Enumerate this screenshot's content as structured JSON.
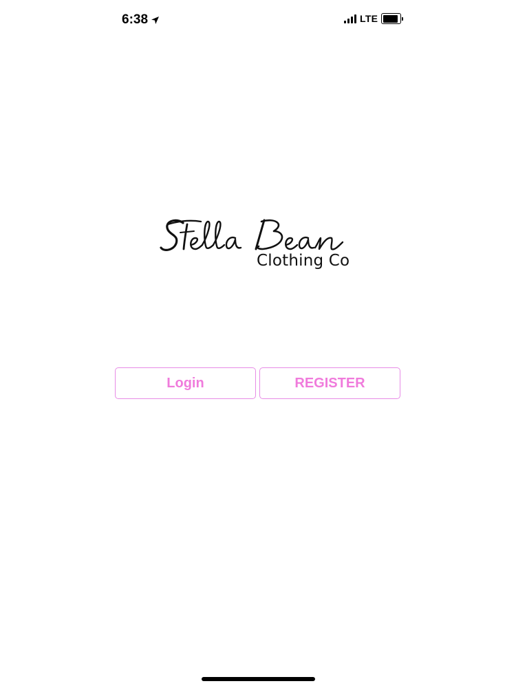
{
  "status_bar": {
    "time": "6:38",
    "location_icon": "location-arrow-icon",
    "network": "LTE",
    "signal_icon": "cellular-signal-icon",
    "battery_icon": "battery-icon",
    "battery_level": 0.9
  },
  "logo": {
    "brand_script": "Stella Bean",
    "subtitle": "Clothing Co"
  },
  "actions": {
    "login_label": "Login",
    "register_label": "REGISTER"
  },
  "colors": {
    "accent": "#f07bdc",
    "button_border": "#e78be6",
    "background": "#ffffff"
  }
}
